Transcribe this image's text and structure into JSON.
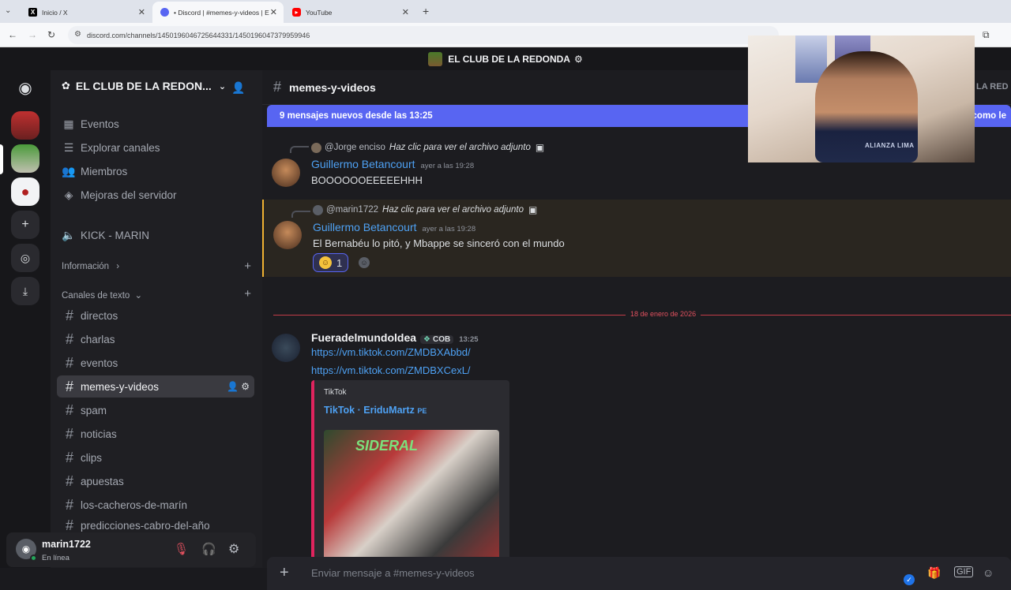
{
  "browser": {
    "tabs": [
      {
        "label": "Inicio / X",
        "icon": "x-logo-icon"
      },
      {
        "label": "• Discord | #memes-y-videos | E",
        "icon": "discord-tab-icon"
      },
      {
        "label": "YouTube",
        "icon": "youtube-icon"
      }
    ],
    "new_tab": "+",
    "url": "discord.com/channels/1450196046725644331/1450196047379959946"
  },
  "banner": {
    "title": "EL CLUB DE LA REDONDA"
  },
  "sidebar": {
    "server_name": "EL CLUB DE LA REDON...",
    "top_items": [
      {
        "label": "Eventos",
        "icon": "calendar-icon"
      },
      {
        "label": "Explorar canales",
        "icon": "browse-channels-icon"
      },
      {
        "label": "Miembros",
        "icon": "members-icon"
      },
      {
        "label": "Mejoras del servidor",
        "icon": "boost-icon"
      }
    ],
    "voice_channel": "KICK - MARIN",
    "category_info": "Información",
    "category_text": "Canales de texto",
    "channels": [
      "directos",
      "charlas",
      "eventos",
      "memes-y-videos",
      "spam",
      "noticias",
      "clips",
      "apuestas",
      "los-cacheros-de-marín",
      "predicciones-cabro-del-año"
    ],
    "selected_channel": "memes-y-videos"
  },
  "user": {
    "name": "marin1722",
    "status": "En línea"
  },
  "chat": {
    "channel": "memes-y-videos",
    "new_messages_banner": "9 mensajes nuevos desde las 13:25",
    "new_messages_right": "como le",
    "messages": [
      {
        "reply_user": "@Jorge enciso",
        "reply_text": "Haz clic para ver el archivo adjunto",
        "author": "Guillermo Betancourt",
        "time": "ayer a las 19:28",
        "text": "BOOOOOOEEEEEHHH"
      },
      {
        "reply_user": "@marin1722",
        "reply_text": "Haz clic para ver el archivo adjunto",
        "author": "Guillermo Betancourt",
        "time": "ayer a las 19:28",
        "text": "El Bernabéu lo pitó, y Mbappe se sinceró con el mundo",
        "reaction_count": "1"
      },
      {
        "author": "Fueradelmundoldea",
        "tag": "COB",
        "time": "13:25",
        "links": [
          "https://vm.tiktok.com/ZMDBXAbbd/",
          "https://vm.tiktok.com/ZMDBXCexL/"
        ],
        "embed": {
          "provider": "TikTok",
          "title": "TikTok · EriduMartz",
          "title_suffix": "PE",
          "thumb_text": "SIDERAL"
        }
      }
    ],
    "date_divider": "18 de enero de 2026",
    "composer_placeholder": "Enviar mensaje a #memes-y-videos"
  },
  "webcam": {
    "shirt_text": "ALIANZA LIMA",
    "side_text_top": "LA RED"
  },
  "colors": {
    "accent": "#5865f2",
    "link": "#4ea1f3",
    "online": "#23a55a",
    "divider": "#e0505e"
  }
}
